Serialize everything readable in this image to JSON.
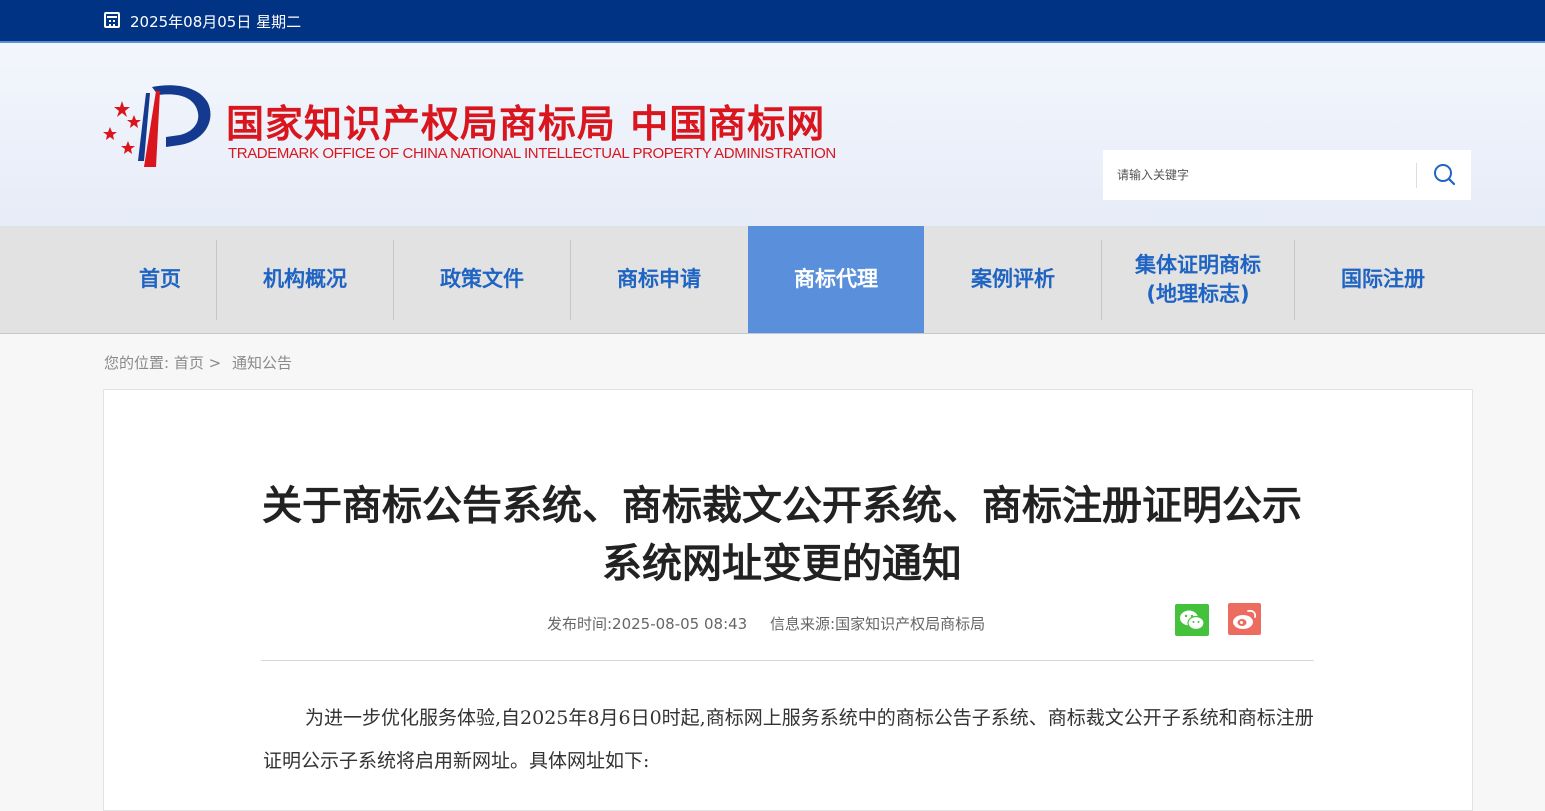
{
  "topbar": {
    "date": "2025年08月05日 星期二"
  },
  "header": {
    "logo_cn": "国家知识产权局商标局 中国商标网",
    "logo_en": "TRADEMARK OFFICE OF CHINA NATIONAL INTELLECTUAL PROPERTY ADMINISTRATION",
    "search_placeholder": "请输入关键字"
  },
  "nav": {
    "items": [
      {
        "label": "首页"
      },
      {
        "label": "机构概况"
      },
      {
        "label": "政策文件"
      },
      {
        "label": "商标申请"
      },
      {
        "label": "商标代理",
        "active": true
      },
      {
        "label": "案例评析"
      },
      {
        "label": "集体证明商标\n(地理标志)"
      },
      {
        "label": "国际注册"
      }
    ]
  },
  "breadcrumb": {
    "prefix": "您的位置:",
    "home": "首页",
    "sep": ">",
    "current": "通知公告"
  },
  "article": {
    "title": "关于商标公告系统、商标裁文公开系统、商标注册证明公示系统网址变更的通知",
    "publish_time": "发布时间:2025-08-05 08:43",
    "source": "信息来源:国家知识产权局商标局",
    "paragraph1": "为进一步优化服务体验,自2025年8月6日0时起,商标网上服务系统中的商标公告子系统、商标裁文公开子系统和商标注册证明公示子系统将启用新网址。具体网址如下:"
  },
  "colors": {
    "topbar": "#003383",
    "nav_active": "#5a8fdb",
    "nav_text": "#1f64c3",
    "logo": "#d9161e"
  },
  "icons": {
    "date": "calendar-icon",
    "search": "search-icon",
    "share1": "wechat-icon",
    "share2": "weibo-icon"
  }
}
